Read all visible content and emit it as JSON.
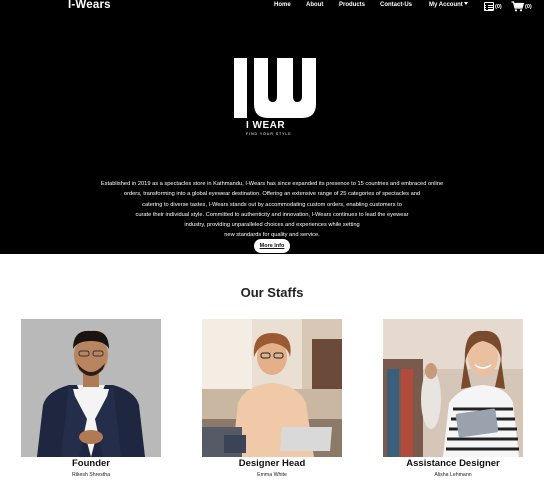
{
  "brand": "I-Wears",
  "nav": {
    "home": "Home",
    "about": "About",
    "products": "Products",
    "contact": "Contact-Us",
    "account": "My Account",
    "wishlist_count": "(0)",
    "cart_count": "(0)"
  },
  "logo": {
    "name": "I WEAR",
    "tagline": "FIND YOUR STYLE"
  },
  "about": {
    "lines": [
      "Established in 2019 as a spectacles store in Kathmandu, I-Wears has since expanded its presence to 15 countries and embraced online",
      "orders, transforming into a global eyewear destination. Offering an extensive range of 25 categories of spectacles and",
      "catering to diverse tastes, I-Wears stands out by accommodating custom orders, enabling customers to",
      "curate their individual style. Committed to authenticity and innovation, I-Wears continues to lead the eyewear",
      "industry, providing unparalleled choices and experiences while setting",
      "new standards for quality and service."
    ],
    "more_button": "More Info"
  },
  "staffs": {
    "title": "Our Staffs",
    "members": [
      {
        "role": "Founder",
        "name": "Rikesh Shrestha"
      },
      {
        "role": "Designer Head",
        "name": "Emma White"
      },
      {
        "role": "Assistance Designer",
        "name": "Alisha Lehmann"
      }
    ]
  }
}
